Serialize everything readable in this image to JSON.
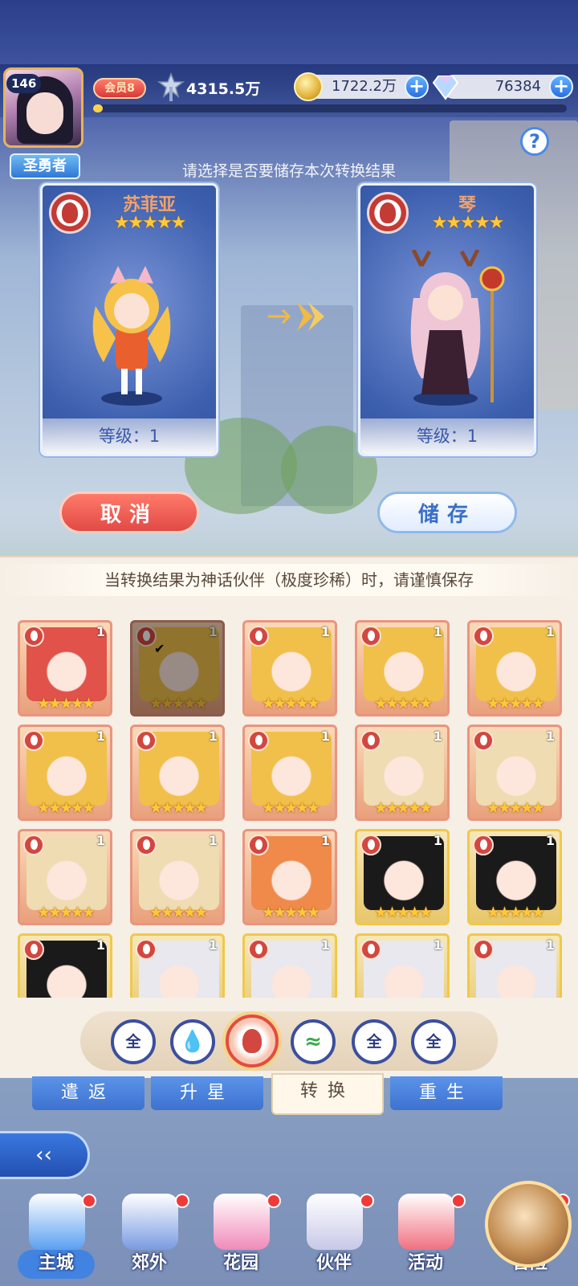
{
  "player": {
    "level": "146",
    "title": "圣勇者",
    "vip": "会员8",
    "power": "4315.5万",
    "exp_fraction": 0.02
  },
  "resources": {
    "gold": "1722.2万",
    "diamonds": "76384"
  },
  "prompt": "请选择是否要储存本次转换结果",
  "left_card": {
    "name": "苏菲亚",
    "stars": "★★★★★",
    "level": "等级：1",
    "element": "fire-icon"
  },
  "right_card": {
    "name": "琴",
    "stars": "★★★★★",
    "level": "等级：1",
    "element": "fire-icon"
  },
  "buttons": {
    "cancel": "取消",
    "save": "储存"
  },
  "notice": "当转换结果为神话伙伴（极度珍稀）时，请谨慎保存",
  "heroes": [
    {
      "level": "1",
      "stars": "★★★★★",
      "frame": "orange",
      "hair": "#e0524a"
    },
    {
      "level": "1",
      "stars": "★★★★★",
      "frame": "orange",
      "hair": "#f0c04a",
      "selected": true
    },
    {
      "level": "1",
      "stars": "★★★★★",
      "frame": "orange",
      "hair": "#f0c04a"
    },
    {
      "level": "1",
      "stars": "★★★★★",
      "frame": "orange",
      "hair": "#f0c04a"
    },
    {
      "level": "1",
      "stars": "★★★★★",
      "frame": "orange",
      "hair": "#f0c04a"
    },
    {
      "level": "1",
      "stars": "★★★★★",
      "frame": "orange",
      "hair": "#f0c04a"
    },
    {
      "level": "1",
      "stars": "★★★★★",
      "frame": "orange",
      "hair": "#f0c04a"
    },
    {
      "level": "1",
      "stars": "★★★★★",
      "frame": "orange",
      "hair": "#f0c04a"
    },
    {
      "level": "1",
      "stars": "★★★★★",
      "frame": "orange",
      "hair": "#efdcb2"
    },
    {
      "level": "1",
      "stars": "★★★★★",
      "frame": "orange",
      "hair": "#efdcb2"
    },
    {
      "level": "1",
      "stars": "★★★★★",
      "frame": "orange",
      "hair": "#efdcb2"
    },
    {
      "level": "1",
      "stars": "★★★★★",
      "frame": "orange",
      "hair": "#efdcb2"
    },
    {
      "level": "1",
      "stars": "★★★★★",
      "frame": "orange",
      "hair": "#f08a4a"
    },
    {
      "level": "1",
      "stars": "★★★★★",
      "frame": "gold",
      "hair": "#1a1a1a"
    },
    {
      "level": "1",
      "stars": "★★★★★",
      "frame": "gold",
      "hair": "#1a1a1a"
    },
    {
      "level": "1",
      "stars": "★★★★★",
      "frame": "gold",
      "hair": "#1a1a1a"
    },
    {
      "level": "1",
      "stars": "★★★★★",
      "frame": "gold",
      "hair": "#e8e8ee"
    },
    {
      "level": "1",
      "stars": "★★★★★",
      "frame": "gold",
      "hair": "#e8e8ee"
    },
    {
      "level": "1",
      "stars": "★★★★★",
      "frame": "gold",
      "hair": "#e8e8ee"
    },
    {
      "level": "1",
      "stars": "★★★★★",
      "frame": "gold",
      "hair": "#e8e8ee"
    }
  ],
  "filters": [
    {
      "label": "全",
      "icon": "all-icon"
    },
    {
      "label": "",
      "icon": "water-icon"
    },
    {
      "label": "",
      "icon": "fire-icon",
      "active": true
    },
    {
      "label": "",
      "icon": "wind-icon"
    },
    {
      "label": "全",
      "icon": "all-icon"
    },
    {
      "label": "全",
      "icon": "all-icon"
    }
  ],
  "tabs": [
    {
      "label": "遣返"
    },
    {
      "label": "升星"
    },
    {
      "label": "转换",
      "active": true
    },
    {
      "label": "重生"
    }
  ],
  "nav": [
    {
      "label": "主城",
      "icon": "castle-icon"
    },
    {
      "label": "郊外",
      "icon": "tower-icon"
    },
    {
      "label": "花园",
      "icon": "heart-icon"
    },
    {
      "label": "伙伴",
      "icon": "partner-icon"
    },
    {
      "label": "活动",
      "icon": "gift-icon"
    },
    {
      "label": "冒险",
      "icon": "compass-icon"
    }
  ],
  "colors": {
    "accent_blue": "#3d72d0",
    "fire": "#d2473f",
    "star": "#ffc83a"
  }
}
